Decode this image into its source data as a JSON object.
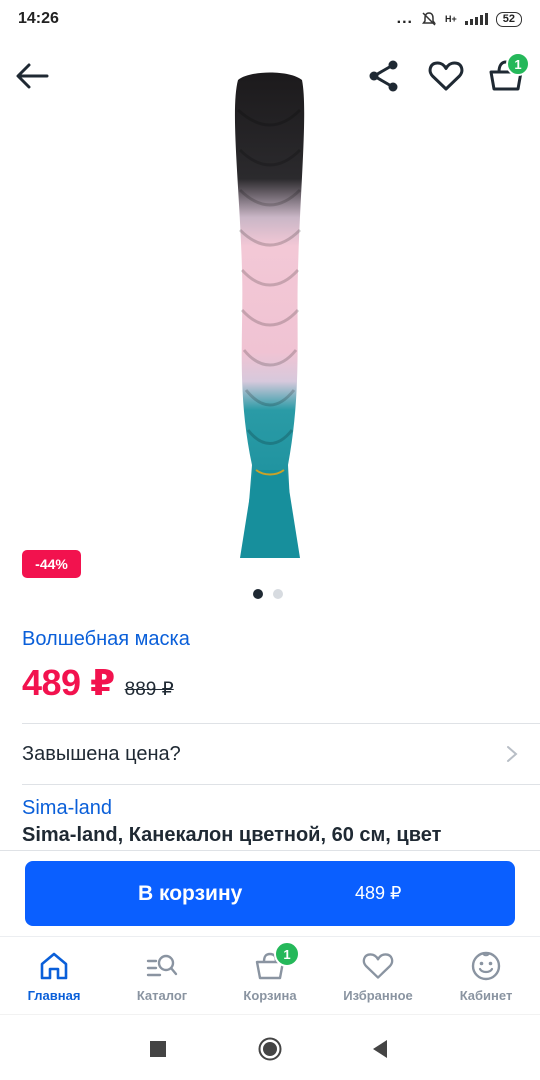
{
  "status_bar": {
    "time": "14:26",
    "dots": "...",
    "network": "H+",
    "battery": "52"
  },
  "header": {
    "back_icon": "arrow-left-icon",
    "share_icon": "share-icon",
    "favorite_icon": "heart-icon",
    "cart_icon": "basket-icon",
    "cart_count": "1"
  },
  "product": {
    "discount": "-44%",
    "image_count": 2,
    "active_image": 1,
    "brand": "Волшебная маска",
    "price": "489 ₽",
    "old_price": "889 ₽",
    "price_question": "Завышена цена?",
    "seller": "Sima-land",
    "title": "Sima-land, Канекалон цветной, 60 см, цвет"
  },
  "add_to_cart": {
    "label": "В корзину",
    "price": "489 ₽"
  },
  "bottom_nav": {
    "items": [
      {
        "label": "Главная",
        "icon": "home-icon",
        "active": true
      },
      {
        "label": "Каталог",
        "icon": "catalog-search-icon",
        "active": false
      },
      {
        "label": "Корзина",
        "icon": "basket-icon",
        "active": false,
        "badge": "1"
      },
      {
        "label": "Избранное",
        "icon": "heart-icon",
        "active": false
      },
      {
        "label": "Кабинет",
        "icon": "smile-icon",
        "active": false
      }
    ]
  },
  "colors": {
    "accent_blue": "#0a5fff",
    "link_blue": "#0a5fd9",
    "price_red": "#f2124e",
    "badge_green": "#25b85a"
  }
}
